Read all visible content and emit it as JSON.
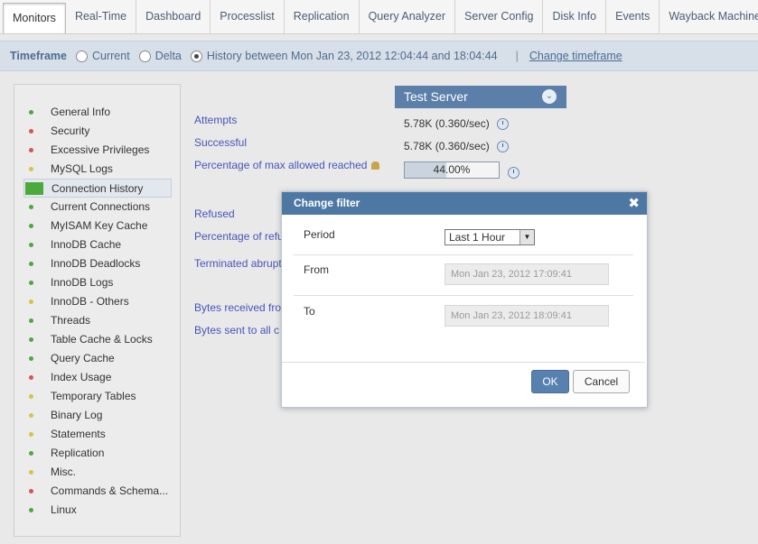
{
  "tabs": [
    {
      "label": "Monitors",
      "active": true
    },
    {
      "label": "Real-Time"
    },
    {
      "label": "Dashboard"
    },
    {
      "label": "Processlist"
    },
    {
      "label": "Replication"
    },
    {
      "label": "Query Analyzer"
    },
    {
      "label": "Server Config"
    },
    {
      "label": "Disk Info"
    },
    {
      "label": "Events"
    },
    {
      "label": "Wayback Machine"
    }
  ],
  "timeframe": {
    "title": "Timeframe",
    "current": "Current",
    "delta": "Delta",
    "history": "History between Mon Jan 23, 2012 12:04:44 and 18:04:44",
    "separator": "|",
    "change_link": "Change timeframe"
  },
  "sidebar": {
    "items": [
      {
        "label": "General Info",
        "status": "green"
      },
      {
        "label": "Security",
        "status": "red"
      },
      {
        "label": "Excessive Privileges",
        "status": "red"
      },
      {
        "label": "MySQL Logs",
        "status": "yellow"
      },
      {
        "label": "Connection History",
        "status": "green",
        "active": true
      },
      {
        "label": "Current Connections",
        "status": "green"
      },
      {
        "label": "MyISAM Key Cache",
        "status": "green"
      },
      {
        "label": "InnoDB Cache",
        "status": "green"
      },
      {
        "label": "InnoDB Deadlocks",
        "status": "green"
      },
      {
        "label": "InnoDB Logs",
        "status": "green"
      },
      {
        "label": "InnoDB - Others",
        "status": "yellow"
      },
      {
        "label": "Threads",
        "status": "green"
      },
      {
        "label": "Table Cache & Locks",
        "status": "green"
      },
      {
        "label": "Query Cache",
        "status": "green"
      },
      {
        "label": "Index Usage",
        "status": "red"
      },
      {
        "label": "Temporary Tables",
        "status": "yellow"
      },
      {
        "label": "Binary Log",
        "status": "yellow"
      },
      {
        "label": "Statements",
        "status": "yellow"
      },
      {
        "label": "Replication",
        "status": "green"
      },
      {
        "label": "Misc.",
        "status": "yellow"
      },
      {
        "label": "Commands & Schema...",
        "status": "red"
      },
      {
        "label": "Linux",
        "status": "green"
      }
    ]
  },
  "colors": {
    "green": "#4caa3c",
    "red": "#d9534f",
    "yellow": "#d8c24a",
    "accent": "#4e78a4"
  },
  "main": {
    "server": "Test Server",
    "rows": [
      {
        "label": "Attempts",
        "value": "5.78K (0.360/sec)"
      },
      {
        "label": "Successful",
        "value": "5.78K (0.360/sec)"
      },
      {
        "label": "Percentage of max allowed reached",
        "value": ""
      },
      {
        "label": "Refused",
        "value": ""
      },
      {
        "label": "Percentage of refu",
        "value": ""
      },
      {
        "label": "Terminated abrupt",
        "value": ""
      },
      {
        "label": "Bytes received fro",
        "value": ""
      },
      {
        "label": "Bytes sent to all c",
        "value": ""
      }
    ],
    "progress": {
      "text": "44.00%",
      "fraction": 0.44
    }
  },
  "modal": {
    "title": "Change filter",
    "close": "✖",
    "period_label": "Period",
    "period_value": "Last 1 Hour",
    "from_label": "From",
    "from_value": "Mon Jan 23, 2012 17:09:41",
    "to_label": "To",
    "to_value": "Mon Jan 23, 2012 18:09:41",
    "ok": "OK",
    "cancel": "Cancel"
  }
}
